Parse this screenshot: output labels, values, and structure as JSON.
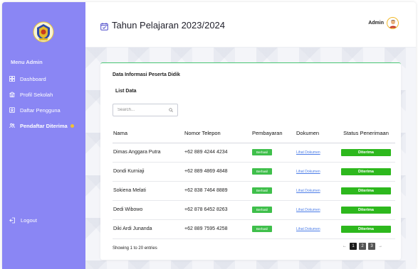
{
  "sidebar": {
    "menu_title": "Menu Admin",
    "items": [
      {
        "label": "Dashboard",
        "icon": "grid-icon",
        "active": false
      },
      {
        "label": "Profil Sekolah",
        "icon": "school-icon",
        "active": false
      },
      {
        "label": "Daftar Pengguna",
        "icon": "user-card-icon",
        "active": false
      },
      {
        "label": "Pendaftar Diterima",
        "icon": "users-icon",
        "active": true
      }
    ],
    "logout_label": "Logout"
  },
  "header": {
    "title": "Tahun Pelajaran 2023/2024",
    "user_name": "Admin"
  },
  "card": {
    "title": "Data Informasi Peserta Didik",
    "list_title": "List Data",
    "search": {
      "placeholder": "Search...",
      "value": ""
    }
  },
  "table": {
    "columns": [
      "Nama",
      "Nomor Telepon",
      "Pembayaran",
      "Dokumen",
      "Status Penerimaan"
    ],
    "rows": [
      {
        "nama": "Dimas Anggara Putra",
        "telepon": "+62 889 4244 4234",
        "pembayaran": "Berhasil",
        "dokumen": "Lihat Dokumen",
        "status": "Diterima"
      },
      {
        "nama": "Dondi Kurniaji",
        "telepon": "+62 889 4869 4848",
        "pembayaran": "Berhasil",
        "dokumen": "Lihat Dokumen",
        "status": "Diterima"
      },
      {
        "nama": "Sokiena Melati",
        "telepon": "+62 838 7464 8889",
        "pembayaran": "Berhasil",
        "dokumen": "Lihat Dokumen",
        "status": "Diterima"
      },
      {
        "nama": "Dedi Wibowo",
        "telepon": "+62 878 6452 8263",
        "pembayaran": "Berhasil",
        "dokumen": "Lihat Dokumen",
        "status": "Diterima"
      },
      {
        "nama": "Diki Ardi Junanda",
        "telepon": "+62 889 7595 4258",
        "pembayaran": "Berhasil",
        "dokumen": "Lihat Dokumen",
        "status": "Diterima"
      }
    ]
  },
  "footer": {
    "info": "Showing 1 to 20 entries",
    "prev": "←",
    "next": "→",
    "pages": [
      "1",
      "2",
      "3"
    ],
    "current_page": "1"
  },
  "colors": {
    "sidebar": "#8a86f4",
    "accent_green": "#2db81d",
    "payment_green": "#3fbf4b",
    "link_blue": "#4c7de8",
    "active_dot": "#f2c230"
  }
}
